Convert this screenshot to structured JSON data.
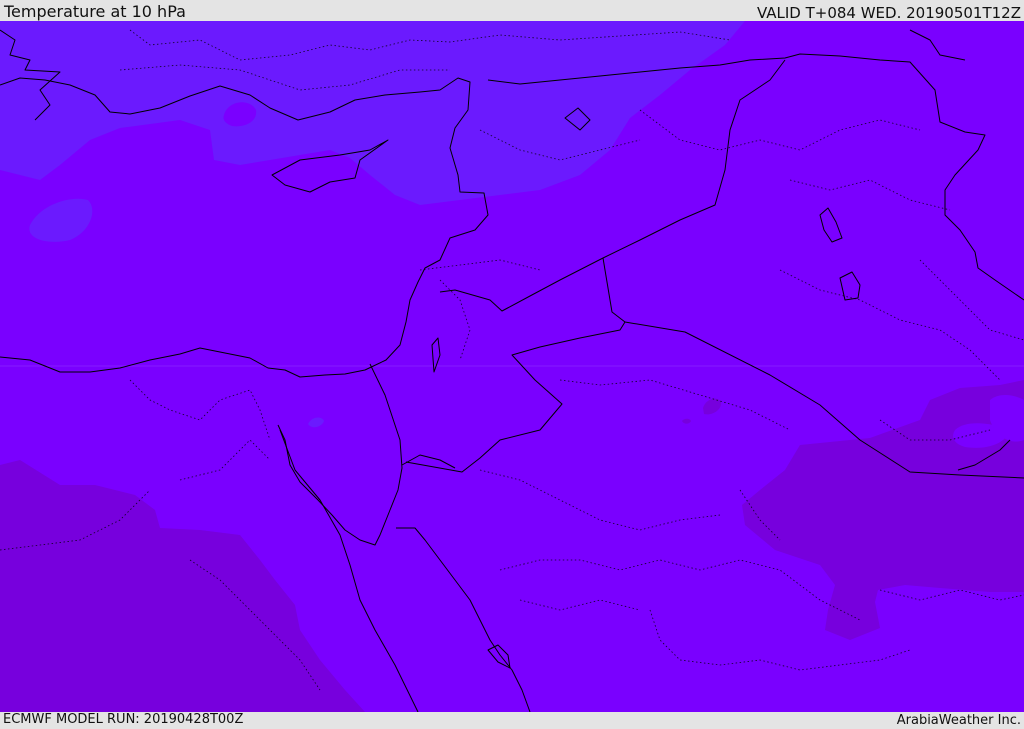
{
  "header": {
    "title": "Temperature at 10 hPa",
    "valid": "VALID T+084 WED. 20190501T12Z"
  },
  "footer": {
    "model_run": "ECMWF MODEL RUN: 20190428T00Z",
    "credit": "ArabiaWeather Inc."
  },
  "colors": {
    "band_cool": "#6b1afe",
    "band_mid": "#7a00ff",
    "band_warm": "#7700dd",
    "coast": "#000000",
    "frame": "#e4e4e4"
  }
}
